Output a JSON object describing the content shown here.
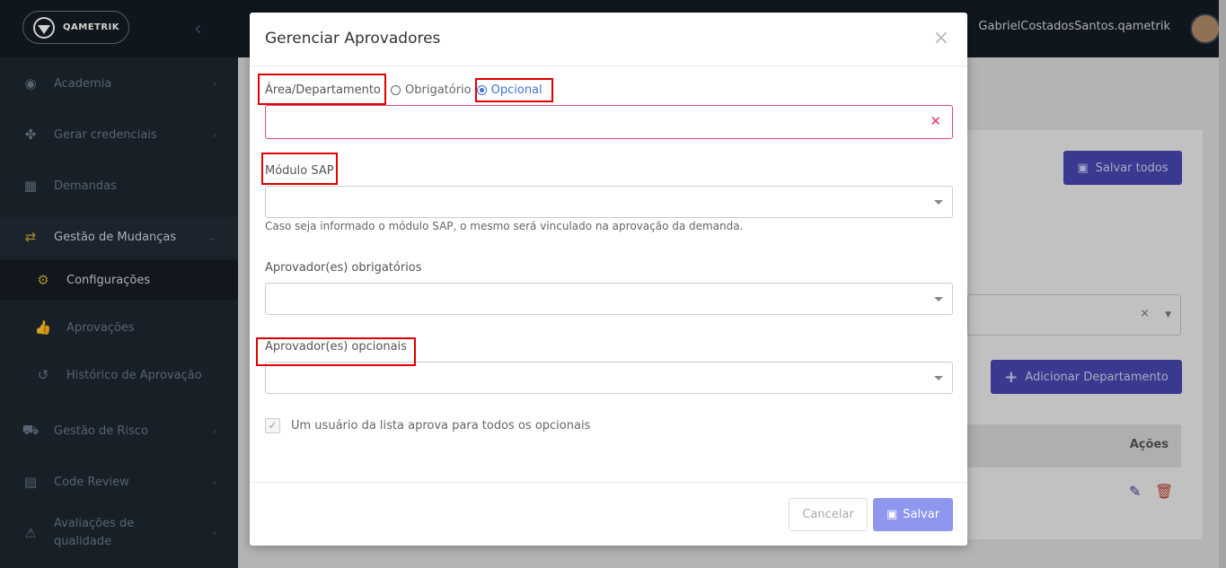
{
  "app": {
    "brand": "QAMETRIK",
    "user_name": "GabrielCostadosSantos.qametrik"
  },
  "sidebar": {
    "items": [
      {
        "label": "Academia"
      },
      {
        "label": "Gerar credenciais"
      },
      {
        "label": "Demandas"
      },
      {
        "label": "Gestão de Mudanças"
      },
      {
        "label": "Configurações"
      },
      {
        "label": "Aprovações"
      },
      {
        "label": "Histórico de Aprovação"
      },
      {
        "label": "Gestão de Risco"
      },
      {
        "label": "Code Review"
      },
      {
        "label": "Avaliações de qualidade"
      }
    ]
  },
  "background": {
    "save_all_label": "Salvar todos",
    "add_dept_label": "Adicionar Departamento",
    "table_actions_header": "Ações"
  },
  "modal": {
    "title": "Gerenciar Aprovadores",
    "area_label": "Área/Departamento",
    "radio_obrigatorio": "Obrigatório",
    "radio_opcional": "Opcional",
    "selected_option": "Opcional",
    "modulo_label": "Módulo SAP",
    "modulo_help": "Caso seja informado o módulo SAP, o mesmo será vinculado na aprovação da demanda.",
    "aprov_obrig_label": "Aprovador(es) obrigatórios",
    "aprov_opc_label": "Aprovador(es) opcionais",
    "checkbox_label": "Um usuário da lista aprova para todos os opcionais",
    "cancel_label": "Cancelar",
    "save_label": "Salvar"
  },
  "colors": {
    "primary": "#4646b0",
    "save_disabled": "#8e96ee",
    "error_border": "#d6488a",
    "annotation_red": "#e00000"
  }
}
